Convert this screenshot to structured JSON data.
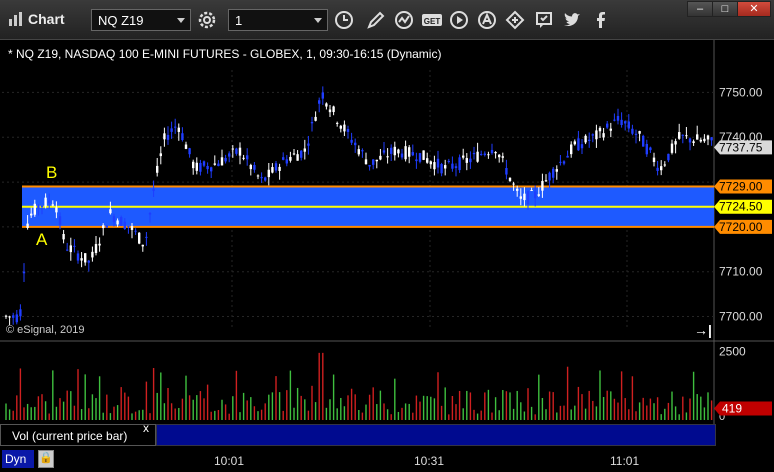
{
  "app": {
    "title": "Chart"
  },
  "toolbar": {
    "symbol": "NQ Z19",
    "interval": "1",
    "icons": [
      "gear-icon",
      "clock-icon",
      "pencil-icon",
      "study-icon",
      "get-icon",
      "play-icon",
      "alert-icon",
      "link-icon",
      "comment-icon",
      "twitter-icon",
      "facebook-icon"
    ]
  },
  "window": {
    "min": "–",
    "max": "□",
    "close": "✕"
  },
  "chart": {
    "title": "* NQ Z19, NASDAQ 100 E-MINI FUTURES - GLOBEX, 1, 09:30-16:15 (Dynamic)",
    "watermark": "© eSignal, 2019",
    "current_price": "7737.75",
    "levels": [
      {
        "label": "7729.00",
        "color": "#ff8c00"
      },
      {
        "label": "7724.50",
        "color": "#ffff00"
      },
      {
        "label": "7720.00",
        "color": "#ff8c00"
      }
    ],
    "markers": {
      "a": "A",
      "b": "B"
    }
  },
  "volume": {
    "label": "Vol (current price bar)",
    "close": "x",
    "current": "419",
    "axis_top": "2500",
    "axis_bottom": "0"
  },
  "footer": {
    "dyn": "Dyn",
    "lock": "🔒"
  },
  "chart_data": {
    "type": "candlestick",
    "y_axis_ticks": [
      "7750.00",
      "7740.00",
      "7729.00",
      "7710.00",
      "7700.00"
    ],
    "ylim": [
      7697,
      7755
    ],
    "x_axis_ticks": [
      "10:01",
      "10:31",
      "11:01"
    ],
    "volume_ylim": [
      0,
      2700
    ],
    "highlight_band": {
      "from": 7720.0,
      "to": 7729.0,
      "color": "#1e5aff"
    },
    "pivot_line": 7724.5
  }
}
